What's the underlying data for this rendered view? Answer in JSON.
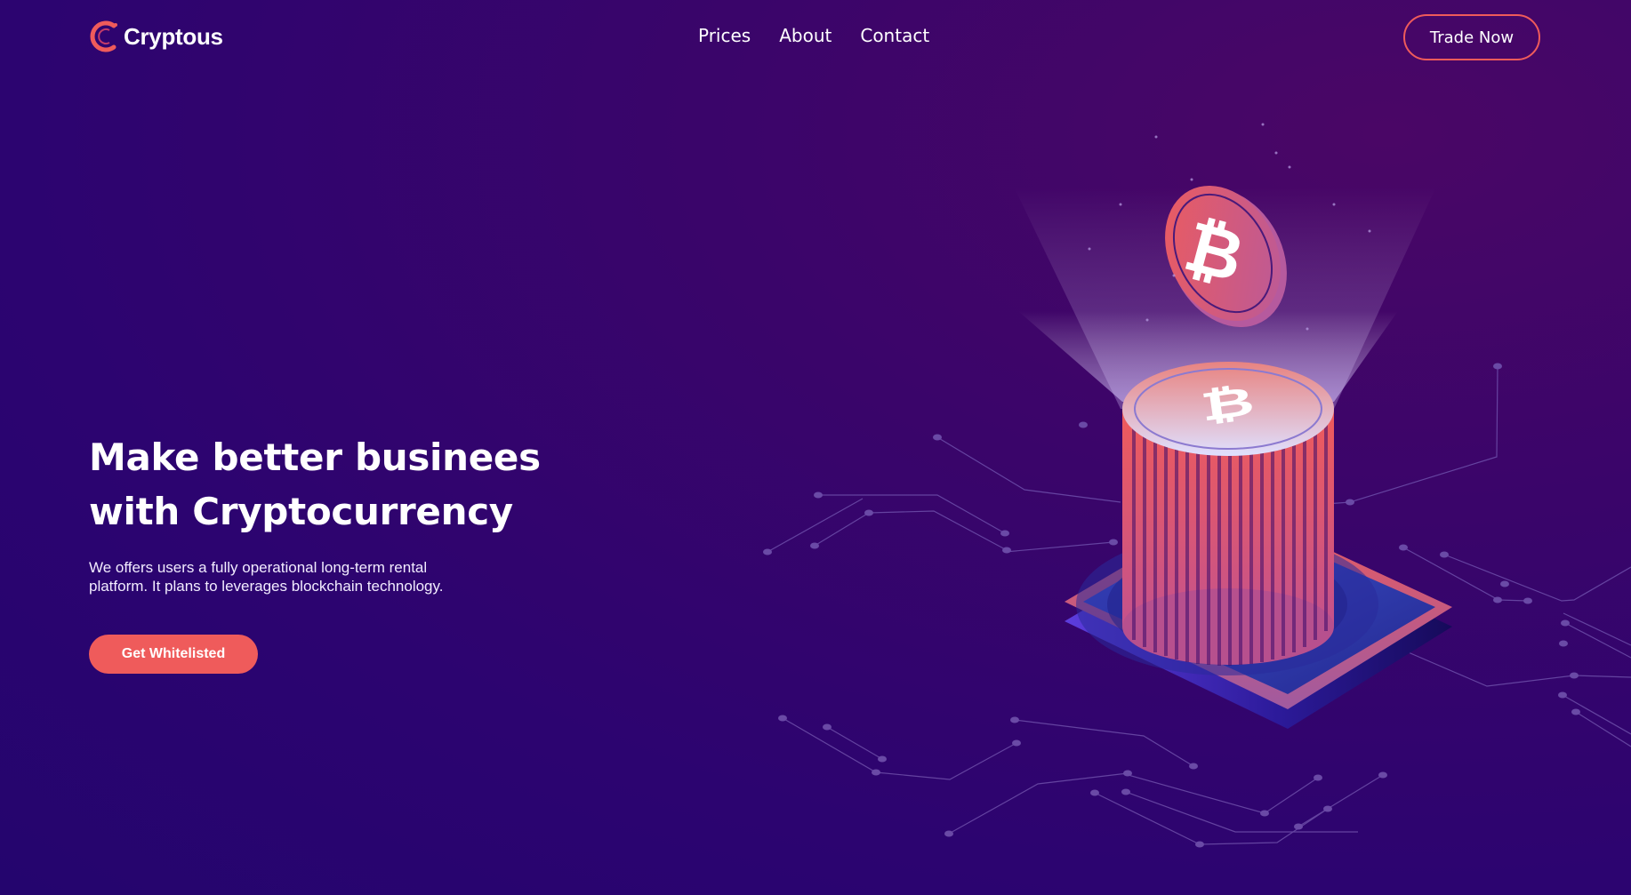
{
  "brand": {
    "name": "Cryptous",
    "accent": "#ef5b5b",
    "background": "#3a056a"
  },
  "nav": {
    "items": [
      {
        "label": "Prices"
      },
      {
        "label": "About"
      },
      {
        "label": "Contact"
      }
    ],
    "cta_label": "Trade Now"
  },
  "hero": {
    "title_line1": "Make better businees",
    "title_line2": "with Cryptocurrency",
    "description": "We offers users a fully operational long-term rental platform. It plans to leverages blockchain technology.",
    "button_label": "Get Whitelisted"
  },
  "illustration": {
    "icons": [
      "bitcoin-coin-icon",
      "bitcoin-tower-icon",
      "circuit-lines"
    ]
  }
}
